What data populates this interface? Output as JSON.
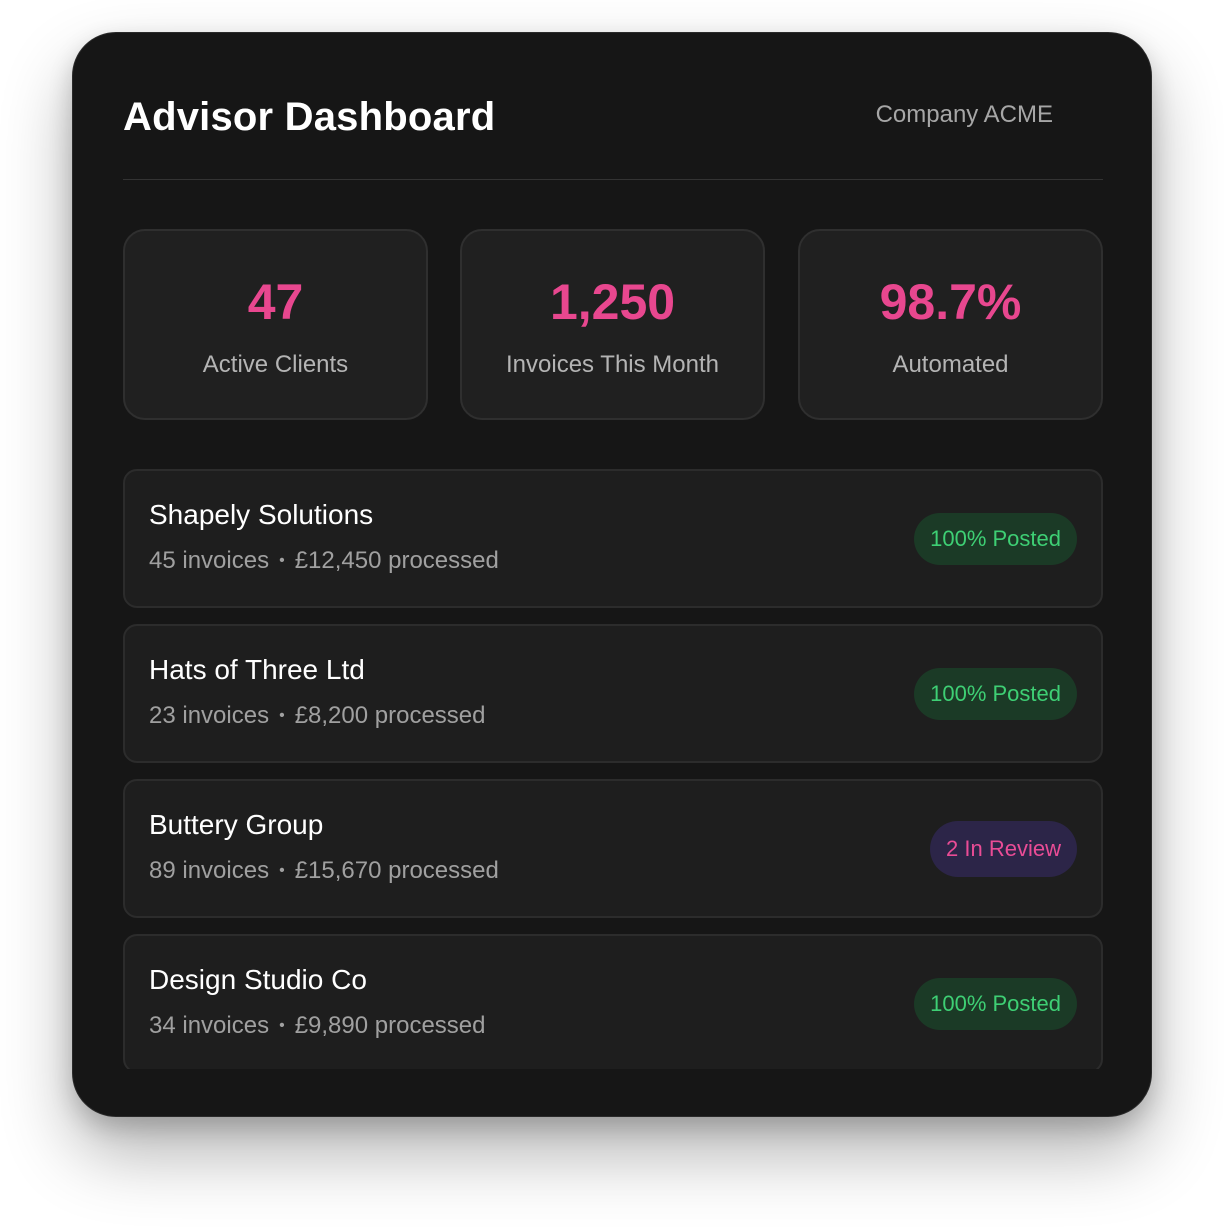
{
  "header": {
    "title": "Advisor Dashboard",
    "company": "Company ACME"
  },
  "stats": [
    {
      "value": "47",
      "label": "Active Clients"
    },
    {
      "value": "1,250",
      "label": "Invoices This Month"
    },
    {
      "value": "98.7%",
      "label": "Automated"
    }
  ],
  "clients": [
    {
      "name": "Shapely Solutions",
      "invoices": "45 invoices",
      "separator": "•",
      "processed": "£12,450 processed",
      "status": "100% Posted"
    },
    {
      "name": "Hats of Three Ltd",
      "invoices": "23 invoices",
      "separator": "•",
      "processed": "£8,200 processed",
      "status": "100% Posted"
    },
    {
      "name": "Buttery Group",
      "invoices": "89 invoices",
      "separator": "•",
      "processed": "£15,670 processed",
      "status": "2 In Review"
    },
    {
      "name": "Design Studio Co",
      "invoices": "34 invoices",
      "separator": "•",
      "processed": "£9,890 processed",
      "status": "100% Posted"
    }
  ],
  "colors": {
    "accent": "#e8478f",
    "posted_text": "#3ecf74",
    "posted_bg": "#1b3a26",
    "review_text": "#ea4c96",
    "review_bg": "#2c2548",
    "panel_bg": "#161616"
  }
}
